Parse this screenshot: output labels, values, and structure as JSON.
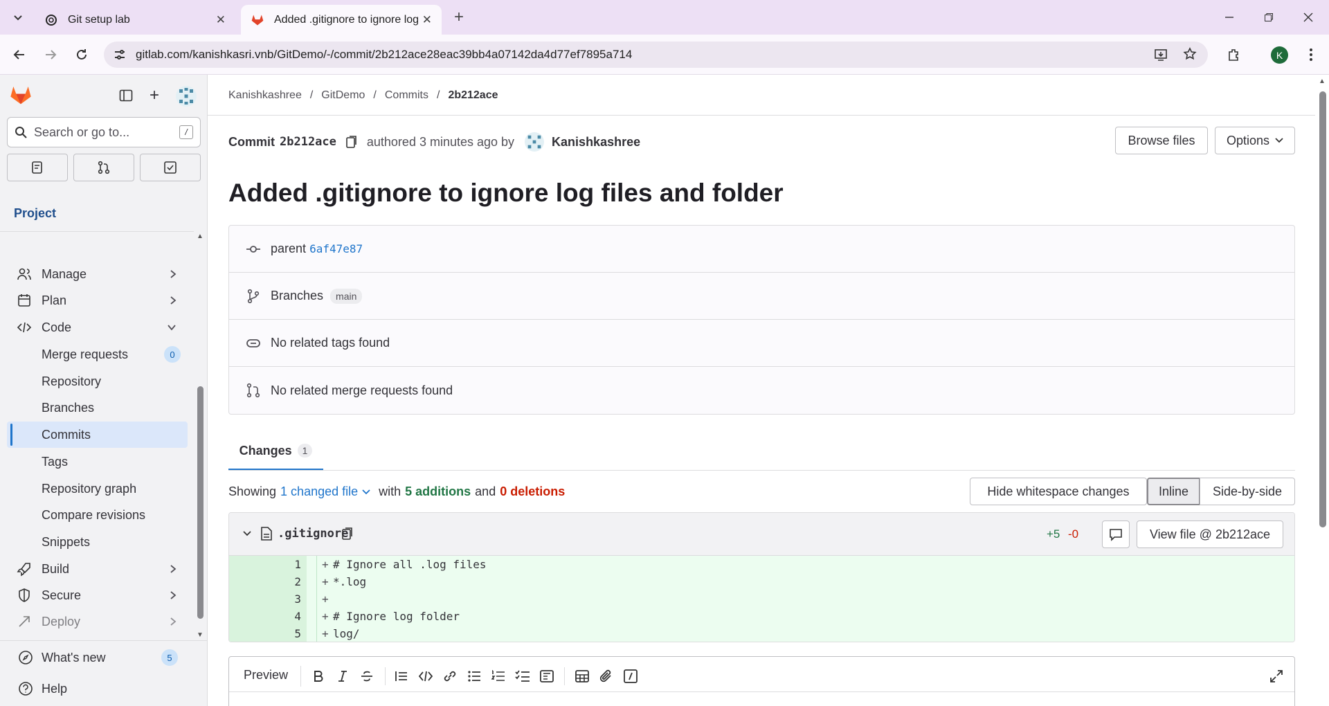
{
  "browser": {
    "tabs": [
      {
        "title": "Git setup lab",
        "active": false
      },
      {
        "title": "Added .gitignore to ignore log fi",
        "active": true
      }
    ],
    "url": "gitlab.com/kanishkasri.vnb/GitDemo/-/commit/2b212ace28eac39bb4a07142da4d77ef7895a714",
    "profile_initial": "K"
  },
  "sidebar": {
    "search_placeholder": "Search or go to...",
    "search_shortcut": "/",
    "section_title": "Project",
    "items": [
      {
        "label": "Manage",
        "icon": "users-icon"
      },
      {
        "label": "Plan",
        "icon": "calendar-icon"
      },
      {
        "label": "Code",
        "icon": "code-icon"
      }
    ],
    "code_subitems": [
      {
        "label": "Merge requests",
        "count": "0"
      },
      {
        "label": "Repository"
      },
      {
        "label": "Branches"
      },
      {
        "label": "Commits",
        "active": true
      },
      {
        "label": "Tags"
      },
      {
        "label": "Repository graph"
      },
      {
        "label": "Compare revisions"
      },
      {
        "label": "Snippets"
      }
    ],
    "more_items": [
      {
        "label": "Build",
        "icon": "rocket-icon"
      },
      {
        "label": "Secure",
        "icon": "shield-icon"
      },
      {
        "label": "Deploy",
        "icon": "deploy-icon"
      }
    ],
    "whats_new": {
      "label": "What's new",
      "count": "5"
    },
    "help": "Help"
  },
  "breadcrumb": [
    "Kanishkashree",
    "GitDemo",
    "Commits",
    "2b212ace"
  ],
  "commit": {
    "label": "Commit",
    "short_sha": "2b212ace",
    "authored": "authored 3 minutes ago by",
    "author": "Kanishkashree",
    "title": "Added .gitignore to ignore log files and folder",
    "parent_label": "parent",
    "parent_sha": "6af47e87",
    "branches_label": "Branches",
    "branch": "main",
    "tags_text": "No related tags found",
    "mr_text": "No related merge requests found"
  },
  "actions": {
    "browse_files": "Browse files",
    "options": "Options"
  },
  "changes": {
    "tab_label": "Changes",
    "tab_count": "1",
    "showing": "Showing",
    "changed_files": "1 changed file",
    "with": "with",
    "additions": "5 additions",
    "and": "and",
    "deletions": "0 deletions",
    "hide_whitespace": "Hide whitespace changes",
    "inline": "Inline",
    "side_by_side": "Side-by-side"
  },
  "file": {
    "name": ".gitignore",
    "added": "+5",
    "removed": "-0",
    "view_file": "View file @ 2b212ace",
    "lines": [
      {
        "n": "1",
        "text": "# Ignore all .log files"
      },
      {
        "n": "2",
        "text": "*.log"
      },
      {
        "n": "3",
        "text": ""
      },
      {
        "n": "4",
        "text": "# Ignore log folder"
      },
      {
        "n": "5",
        "text": "log/"
      }
    ]
  },
  "editor": {
    "preview": "Preview"
  },
  "colors": {
    "accent": "#1f75cb",
    "addition": "#217645",
    "deletion": "#c91c00",
    "diff_bg": "#ecfdf0"
  }
}
